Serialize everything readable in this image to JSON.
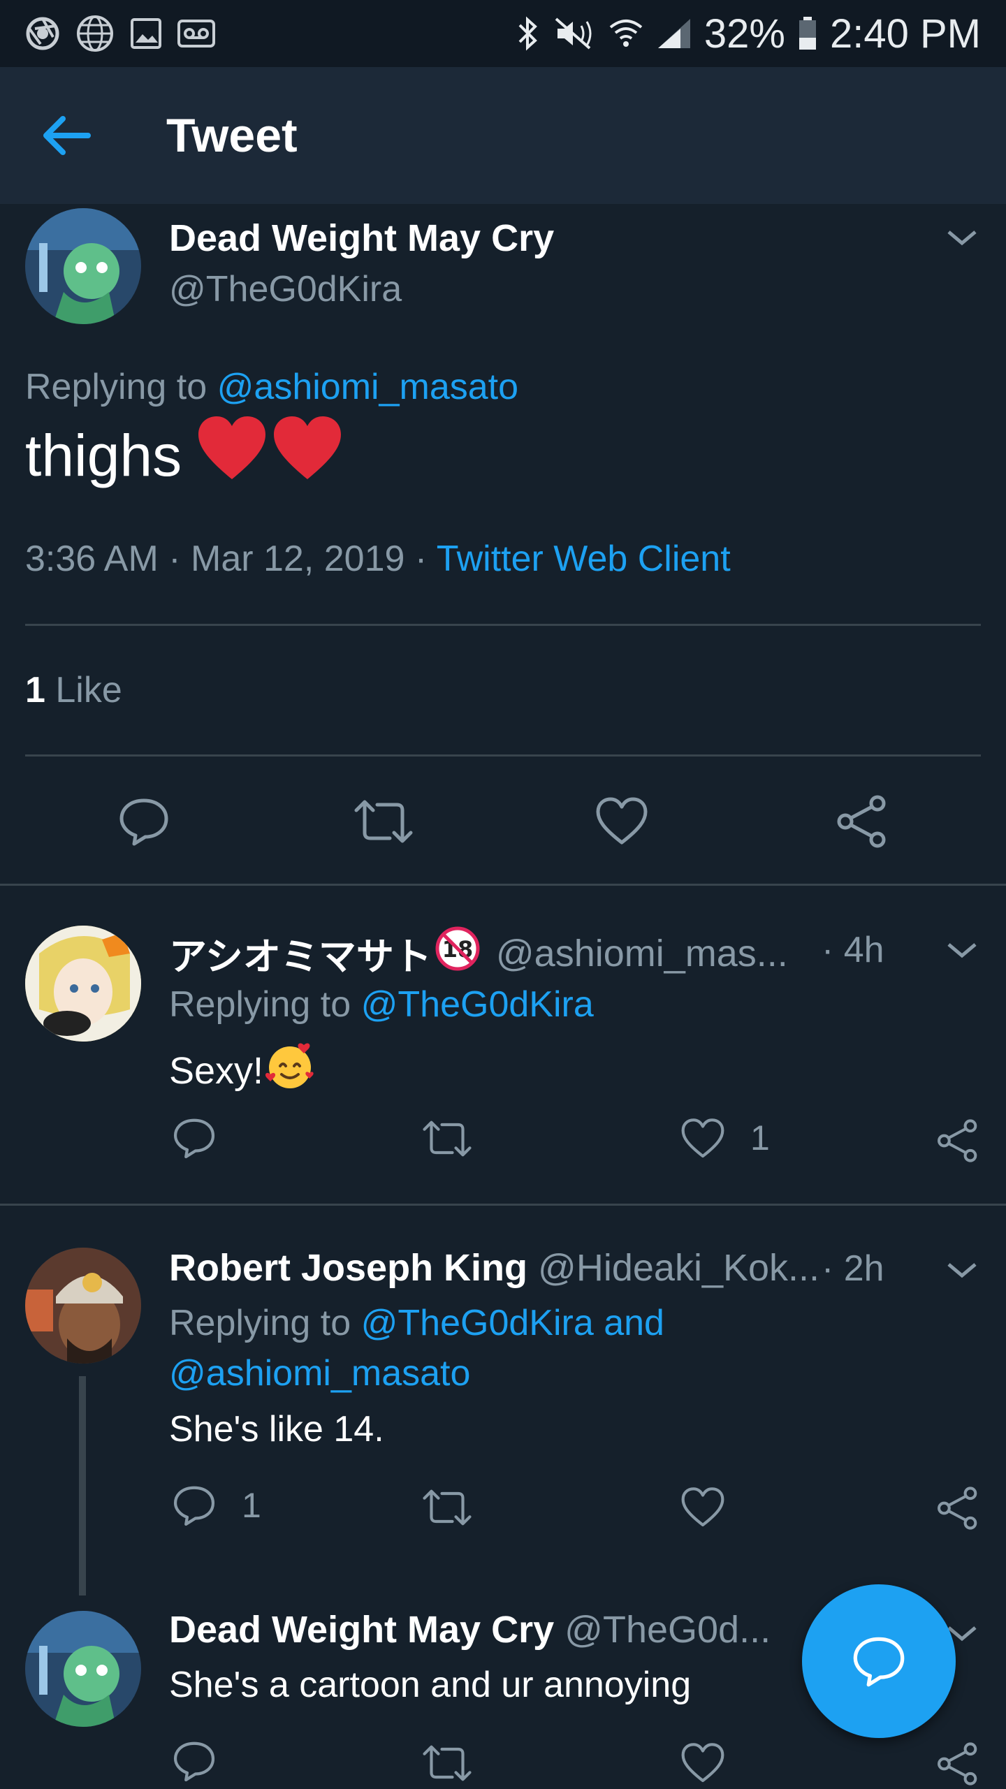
{
  "status_bar": {
    "battery_percent": "32%",
    "time": "2:40 PM",
    "left_icons": [
      "chrome-icon",
      "globe-icon",
      "image-icon",
      "voicemail-icon"
    ],
    "right_icons": [
      "bluetooth-icon",
      "mute-icon",
      "wifi-icon",
      "signal-icon",
      "battery-icon"
    ]
  },
  "header": {
    "title": "Tweet"
  },
  "main_tweet": {
    "author_name": "Dead Weight May Cry",
    "author_handle": "@TheG0dKira",
    "replying_prefix": "Replying to",
    "replying_to": "@ashiomi_masato",
    "text": "thighs",
    "emoji": [
      "red-heart",
      "red-heart"
    ],
    "time": "3:36 AM",
    "date": "Mar 12, 2019",
    "source": "Twitter Web Client",
    "likes_count": "1",
    "likes_label": "Like"
  },
  "replies": [
    {
      "author_name": "アシオミマサト",
      "author_handle": "@ashiomi_mas...",
      "age": "4h",
      "replying_prefix": "Replying to",
      "replying_to": "@TheG0dKira",
      "text": "Sexy!",
      "emoji": "smiling-face-with-hearts",
      "reply_count": "",
      "like_count": "1"
    },
    {
      "author_name": "Robert Joseph King",
      "author_handle": "@Hideaki_Kok...",
      "age": "2h",
      "replying_prefix": "Replying to",
      "replying_to_line1": "@TheG0dKira and",
      "replying_to_line2": "@ashiomi_masato",
      "text": "She's like 14.",
      "reply_count": "1",
      "like_count": ""
    },
    {
      "author_name": "Dead Weight May Cry",
      "author_handle": "@TheG0d...",
      "age": "",
      "text": "She's a cartoon and ur annoying"
    }
  ],
  "colors": {
    "background": "#15202b",
    "header": "#1c2938",
    "status_bar": "#101923",
    "accent": "#1da1f2",
    "muted": "#8899a6",
    "divider": "#38444d",
    "heart": "#e0245e"
  },
  "fab": {
    "icon": "compose-reply-icon"
  }
}
